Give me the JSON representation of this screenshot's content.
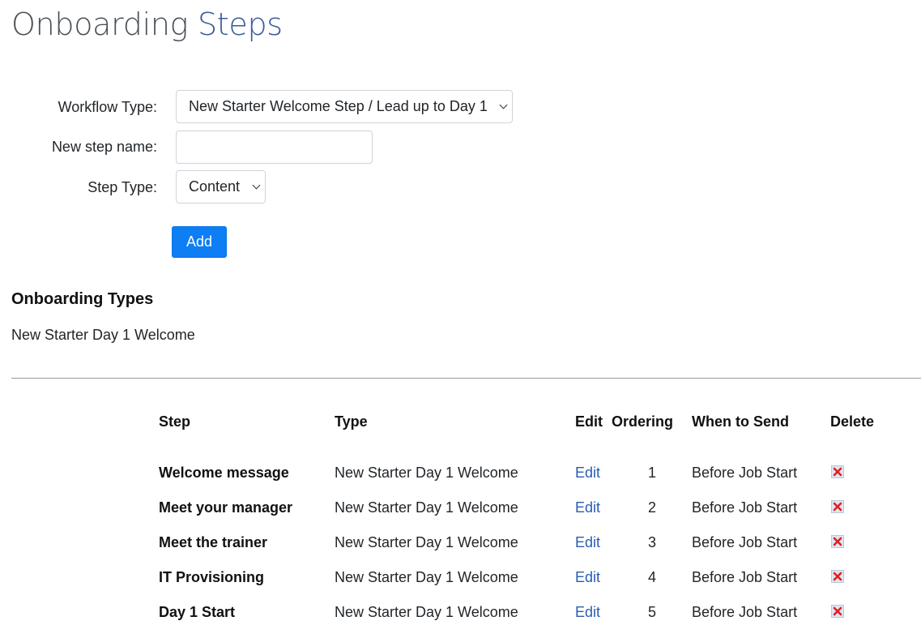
{
  "title": {
    "main": "Onboarding ",
    "accent": "Steps"
  },
  "form": {
    "workflow_label": "Workflow Type:",
    "workflow_value": "New Starter Welcome Step / Lead up to Day 1",
    "step_name_label": "New step name:",
    "step_name_value": "",
    "step_type_label": "Step Type:",
    "step_type_value": "Content",
    "add_label": "Add"
  },
  "onboarding_types": {
    "heading": "Onboarding Types",
    "items": [
      "New Starter Day 1 Welcome"
    ]
  },
  "table": {
    "headers": {
      "step": "Step",
      "type": "Type",
      "edit": "Edit",
      "ordering": "Ordering",
      "when": "When to Send",
      "delete": "Delete"
    },
    "rows": [
      {
        "step": "Welcome message",
        "type": "New Starter Day 1 Welcome",
        "edit": "Edit",
        "ordering": "1",
        "when": "Before Job Start"
      },
      {
        "step": "Meet your manager",
        "type": "New Starter Day 1 Welcome",
        "edit": "Edit",
        "ordering": "2",
        "when": "Before Job Start"
      },
      {
        "step": "Meet the trainer",
        "type": "New Starter Day 1 Welcome",
        "edit": "Edit",
        "ordering": "3",
        "when": "Before Job Start"
      },
      {
        "step": "IT Provisioning",
        "type": "New Starter Day 1 Welcome",
        "edit": "Edit",
        "ordering": "4",
        "when": "Before Job Start"
      },
      {
        "step": "Day 1 Start",
        "type": "New Starter Day 1 Welcome",
        "edit": "Edit",
        "ordering": "5",
        "when": "Before Job Start"
      }
    ],
    "delete_icon": "delete-x-icon"
  },
  "colors": {
    "accent": "#3a5a9a",
    "button": "#0d7ef4",
    "link": "#2a5db0",
    "delete": "#e02020"
  }
}
